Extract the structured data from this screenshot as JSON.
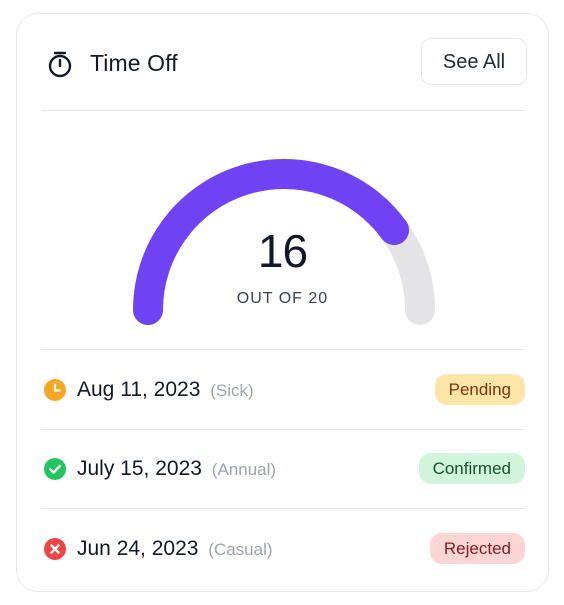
{
  "card": {
    "title": "Time Off",
    "title_icon": "stopwatch-icon",
    "see_all_label": "See All"
  },
  "gauge": {
    "used": 16,
    "total": 20,
    "value_text": "16",
    "caption": "OUT OF 20",
    "fill_color": "#6f43f4",
    "track_color": "#e4e4e7"
  },
  "requests": [
    {
      "date": "Aug 11, 2023",
      "type": "(Sick)",
      "status": "Pending",
      "icon": "clock-icon",
      "icon_color": "#f6a823"
    },
    {
      "date": "July 15, 2023",
      "type": "(Annual)",
      "status": "Confirmed",
      "icon": "check-circle-icon",
      "icon_color": "#22c55e"
    },
    {
      "date": "Jun 24, 2023",
      "type": "(Casual)",
      "status": "Rejected",
      "icon": "x-circle-icon",
      "icon_color": "#ef4444"
    }
  ]
}
